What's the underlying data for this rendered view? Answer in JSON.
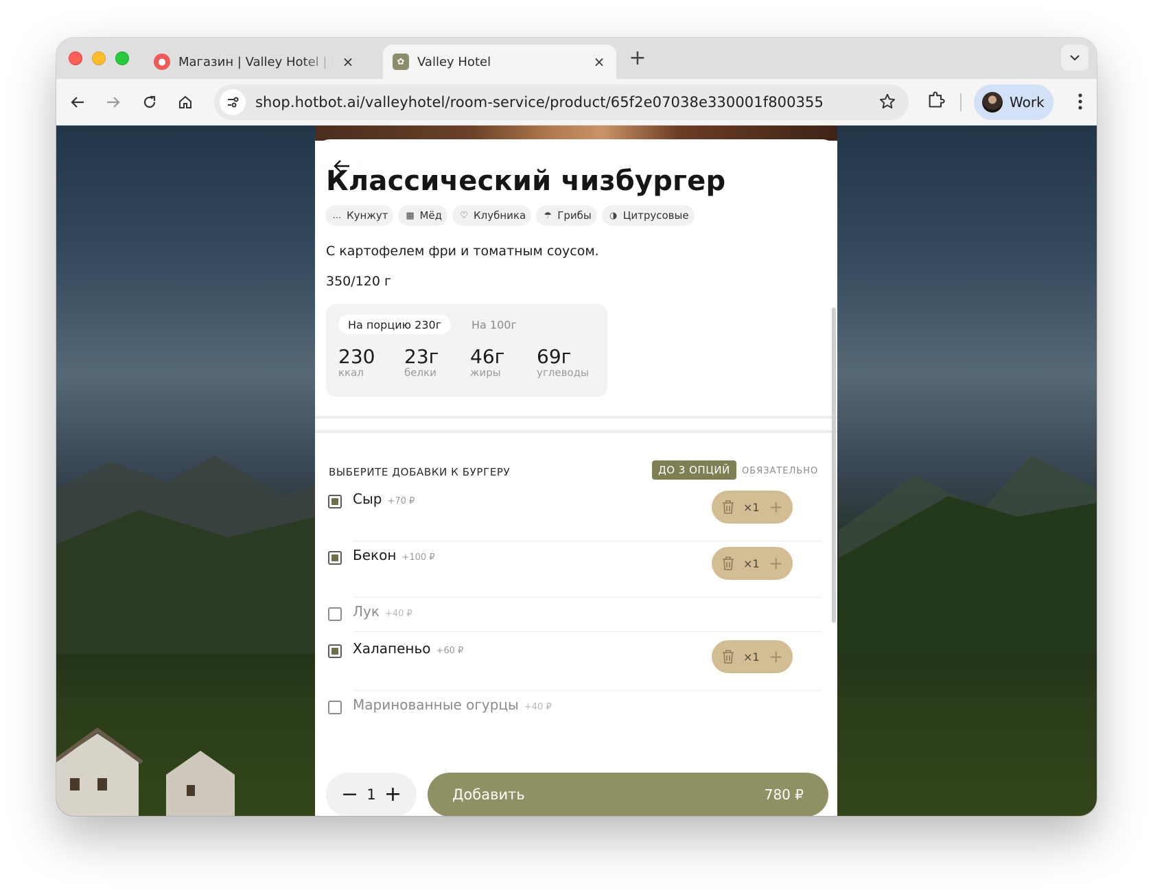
{
  "browser": {
    "tabs": [
      {
        "title": "Магазин | Valley Hotel | Hotbot",
        "active": false
      },
      {
        "title": "Valley Hotel",
        "active": true
      }
    ],
    "new_tab": "+",
    "url": "shop.hotbot.ai/valleyhotel/room-service/product/65f2e07038e330001f800355",
    "profile": "Work"
  },
  "product": {
    "title": "Классический чизбургер",
    "allergens": [
      {
        "label": "Кунжут",
        "icon": "sesame-icon"
      },
      {
        "label": "Мёд",
        "icon": "honey-icon"
      },
      {
        "label": "Клубника",
        "icon": "strawberry-icon"
      },
      {
        "label": "Грибы",
        "icon": "mushroom-icon"
      },
      {
        "label": "Цитрусовые",
        "icon": "citrus-icon"
      }
    ],
    "description": "С картофелем фри и томатным соусом.",
    "weight": "350/120 г"
  },
  "nutrition": {
    "tab_portion": "На порцию 230г",
    "tab_100g": "На 100г",
    "items": [
      {
        "value": "230",
        "unit": "ккал"
      },
      {
        "value": "23г",
        "unit": "белки"
      },
      {
        "value": "46г",
        "unit": "жиры"
      },
      {
        "value": "69г",
        "unit": "углеводы"
      }
    ]
  },
  "addons": {
    "title": "ВЫБЕРИТЕ ДОБАВКИ К БУРГЕРУ",
    "limit_badge": "ДО 3 ОПЦИЙ",
    "required": "ОБЯЗАТЕЛЬНО",
    "options": [
      {
        "name": "Сыр",
        "price": "+70 ₽",
        "checked": true,
        "count": "×1"
      },
      {
        "name": "Бекон",
        "price": "+100 ₽",
        "checked": true,
        "count": "×1"
      },
      {
        "name": "Лук",
        "price": "+40 ₽",
        "checked": false,
        "count": ""
      },
      {
        "name": "Халапеньо",
        "price": "+60 ₽",
        "checked": true,
        "count": "×1"
      },
      {
        "name": "Маринованные огурцы",
        "price": "+40 ₽",
        "checked": false,
        "count": ""
      }
    ]
  },
  "cart": {
    "quantity": "1",
    "minus": "−",
    "plus": "+",
    "add_label": "Добавить",
    "total": "780 ₽"
  },
  "colors": {
    "accent_olive": "#8f9064",
    "badge_olive": "#7e7f55",
    "stepper_tan": "#d3bd94"
  }
}
